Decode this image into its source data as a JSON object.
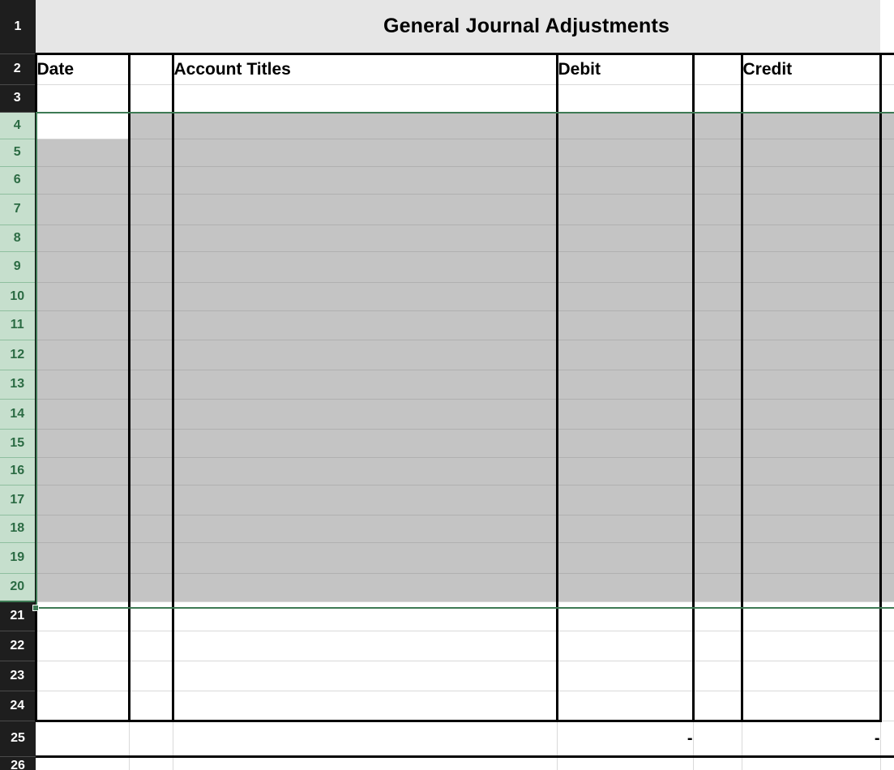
{
  "app": {
    "type": "spreadsheet",
    "row_header_selected_range": "4:20",
    "active_cell": "A4"
  },
  "colors": {
    "selection_border": "#3d7a54",
    "selection_fill": "#c4c4c4",
    "row_header_bg": "#1e1e1e",
    "row_header_selected_bg": "#c6dfcd",
    "row_header_selected_text": "#2b6b43",
    "title_bg": "#e6e6e6",
    "grid_line": "#d9d9d9",
    "heavy_border": "#000000"
  },
  "title": {
    "text": "General Journal Adjustments"
  },
  "headers": {
    "date": "Date",
    "blank_b": "",
    "account_titles": "Account Titles",
    "debit": "Debit",
    "blank_e": "",
    "credit": "Credit"
  },
  "row_numbers": [
    "1",
    "2",
    "3",
    "4",
    "5",
    "6",
    "7",
    "8",
    "9",
    "10",
    "11",
    "12",
    "13",
    "14",
    "15",
    "16",
    "17",
    "18",
    "19",
    "20",
    "21",
    "22",
    "23",
    "24",
    "25",
    "26"
  ],
  "totals_row": {
    "row": "25",
    "date": "",
    "col_b": "",
    "account_titles": "",
    "debit": "-",
    "col_e": "",
    "credit": "-"
  },
  "empty_cell": ""
}
